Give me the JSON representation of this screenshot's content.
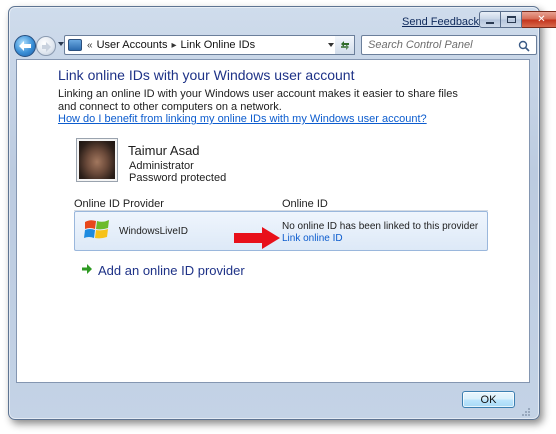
{
  "titlebar": {
    "send_feedback": "Send Feedback",
    "minimize_icon": "minimize-icon",
    "maximize_icon": "maximize-icon",
    "close_icon": "close-icon",
    "close_glyph": "✕"
  },
  "navigation": {
    "back_icon": "back-arrow-icon",
    "forward_icon": "forward-arrow-icon",
    "address": {
      "root_icon": "control-panel-icon",
      "root_separator": "«",
      "breadcrumbs": [
        "User Accounts",
        "Link Online IDs"
      ],
      "crumb_separator": "▸"
    },
    "refresh_icon": "refresh-icon",
    "search": {
      "placeholder": "Search Control Panel",
      "value": "",
      "icon": "search-icon"
    }
  },
  "main": {
    "heading": "Link online IDs with your Windows user account",
    "description": "Linking an online ID with your Windows user account makes it easier to share files and connect to other computers on a network.",
    "help_link": "How do I benefit from linking my online IDs with my Windows user account?",
    "user": {
      "name": "Taimur Asad",
      "role": "Administrator",
      "password_status": "Password protected"
    },
    "table": {
      "columns": [
        "Online ID Provider",
        "Online ID"
      ],
      "rows": [
        {
          "provider": "WindowsLiveID",
          "provider_icon": "windows-logo-icon",
          "status": "No online ID has been linked to this provider",
          "action": "Link online ID"
        }
      ]
    },
    "annotation_arrow": "red-arrow-icon",
    "add_provider": "Add an online ID provider",
    "add_provider_icon": "green-arrow-icon"
  },
  "footer": {
    "ok_label": "OK"
  },
  "colors": {
    "heading": "#1e3287",
    "link": "#0c5cce",
    "row_highlight": "#dde9f7",
    "annotation": "#e8101a",
    "close_button": "#c2331c"
  }
}
